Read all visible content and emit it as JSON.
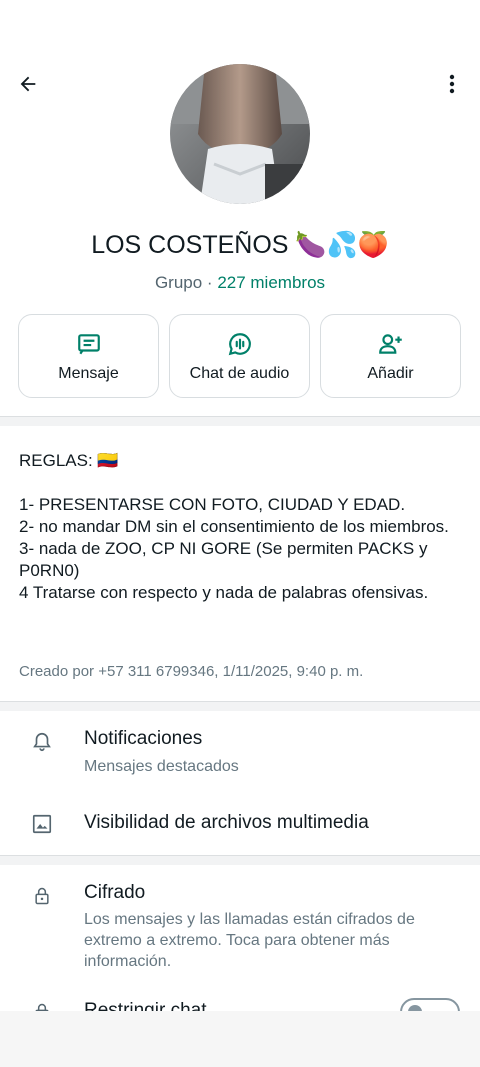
{
  "header": {
    "back_icon": "arrow-left-icon",
    "menu_icon": "more-vert-icon"
  },
  "group": {
    "name": "LOS COSTEÑOS 🍆💦🍑",
    "type_label": "Grupo",
    "separator": " · ",
    "members_label": "227 miembros"
  },
  "actions": [
    {
      "label": "Mensaje",
      "icon": "message-icon"
    },
    {
      "label": "Chat de audio",
      "icon": "audio-chat-icon"
    },
    {
      "label": "Añadir",
      "icon": "add-person-icon"
    }
  ],
  "description": {
    "text": "REGLAS: 🇨🇴\n\n1- PRESENTARSE CON FOTO, CIUDAD Y EDAD.\n2- no mandar DM sin el consentimiento de los miembros.\n3- nada de ZOO, CP NI GORE (Se permiten PACKS y P0RN0)\n4 Tratarse con respecto y nada de palabras ofensivas.",
    "created_by": "Creado por +57 311 6799346, 1/11/2025, 9:40 p. m."
  },
  "settings": {
    "notifications": {
      "title": "Notificaciones",
      "subtitle": "Mensajes destacados",
      "icon": "bell-icon"
    },
    "media_visibility": {
      "title": "Visibilidad de archivos multimedia",
      "icon": "image-icon"
    },
    "encryption": {
      "title": "Cifrado",
      "subtitle": "Los mensajes y las llamadas están cifrados de extremo a extremo. Toca para obtener más información.",
      "icon": "lock-icon"
    },
    "restrict_chat": {
      "title": "Restringir chat",
      "icon": "lock-icon",
      "toggle_on": false
    }
  },
  "colors": {
    "accent": "#008069",
    "text_primary": "#111b21",
    "text_secondary": "#667781"
  }
}
